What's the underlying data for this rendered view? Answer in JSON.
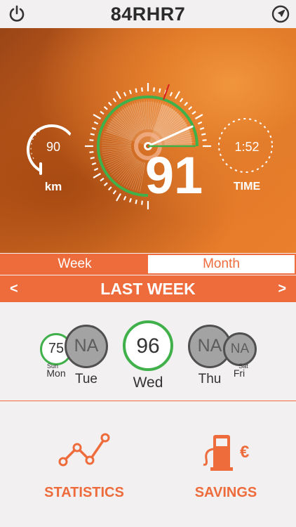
{
  "header": {
    "title": "84RHR7"
  },
  "gauges": {
    "distance": {
      "value": "90",
      "unit": "km"
    },
    "score": {
      "value": "91"
    },
    "time": {
      "value": "1:52",
      "label": "TIME"
    }
  },
  "tabs": [
    {
      "label": "Week"
    },
    {
      "label": "Month"
    }
  ],
  "period": {
    "label": "LAST WEEK",
    "prev": "<",
    "next": ">"
  },
  "days": [
    {
      "day": "Sun",
      "score": ""
    },
    {
      "day": "Mon",
      "score": "75"
    },
    {
      "day": "Tue",
      "score": "NA"
    },
    {
      "day": "Wed",
      "score": "96"
    },
    {
      "day": "Thu",
      "score": "NA"
    },
    {
      "day": "Fri",
      "score": "NA"
    },
    {
      "day": "Sat",
      "score": ""
    }
  ],
  "actions": {
    "statistics": "STATISTICS",
    "savings": "SAVINGS"
  },
  "colors": {
    "accent": "#ee6b3c",
    "good": "#40b04a",
    "text": "#2b2b2b"
  }
}
